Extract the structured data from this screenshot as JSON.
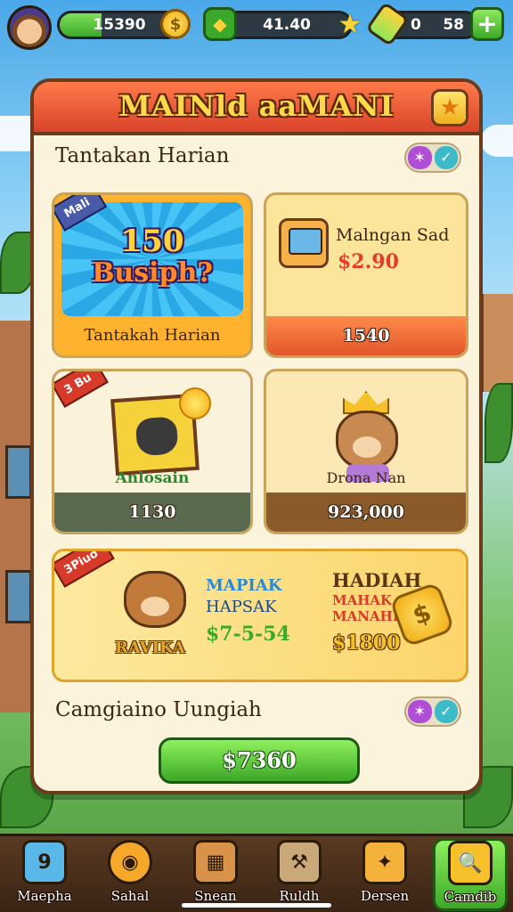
{
  "hud": {
    "coins_value": "15390",
    "coin_symbol": "$",
    "gems_value": "41.40",
    "gems_progress": 0.55,
    "energy_left": "0",
    "energy_right": "58",
    "plus": "+",
    "coins_progress": 0.35
  },
  "panel": {
    "title": "MAINld aaMANI",
    "star": "★"
  },
  "daily": {
    "title": "Tantakan Harian",
    "toggle_a": "✶",
    "toggle_b": "✓"
  },
  "cards": {
    "c1": {
      "ribbon": "Mali",
      "number": "150",
      "word": "Busiph?",
      "footer": "Tantakah Harian"
    },
    "c2": {
      "label": "Malngan Sad",
      "price": "$2.90",
      "footer": "1540"
    },
    "c3": {
      "ribbon": "3 Bu",
      "label": "Anlosain",
      "footer": "1130"
    },
    "c4": {
      "label": "Drona Nan",
      "footer": "923,000"
    },
    "c5": {
      "ribbon": "3Piuo",
      "bear_name": "RAVIKA",
      "line1": "MAPIAK",
      "line2": "HAPSAK",
      "line3": "$7-5-54",
      "h1": "HADIAH",
      "h2a": "MAHAK",
      "h2b": "MANAHK",
      "h3": "$1800",
      "bag_symbol": "$"
    }
  },
  "bottom_section": {
    "title": "Camgiaino Uungiah",
    "toggle_a": "✶",
    "toggle_b": "✓",
    "button": "$7360"
  },
  "nav": {
    "items": [
      {
        "label": "Maepha",
        "icon": "9"
      },
      {
        "label": "Sahal",
        "icon": "◉"
      },
      {
        "label": "Snean",
        "icon": "▦"
      },
      {
        "label": "Ruldh",
        "icon": "⚒"
      },
      {
        "label": "Dersen",
        "icon": "✦"
      },
      {
        "label": "Camdib",
        "icon": "🔍"
      }
    ]
  },
  "colors": {
    "accent_green": "#3ca828",
    "header_red": "#d9442a",
    "gold": "#f5c02a"
  }
}
